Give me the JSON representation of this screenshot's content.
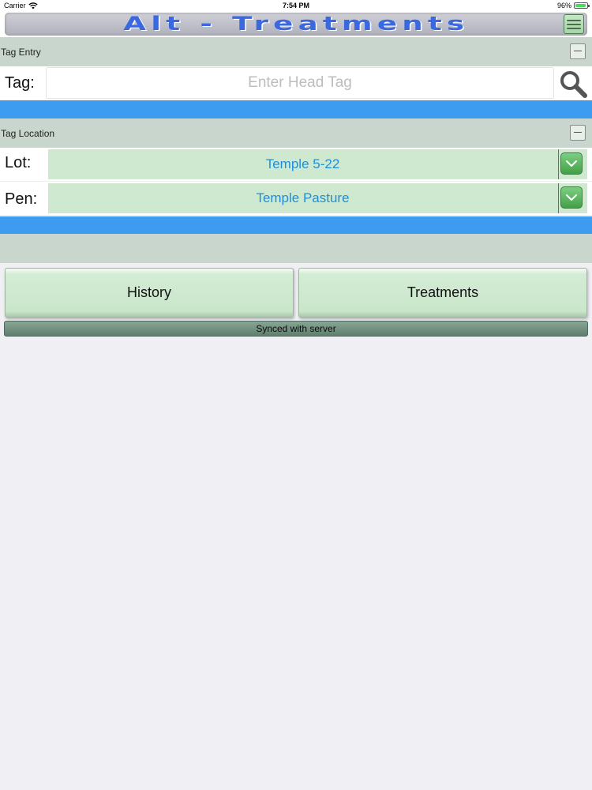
{
  "status_bar": {
    "carrier": "Carrier",
    "time": "7:54 PM",
    "battery_percent": "96%",
    "battery_level": 0.96
  },
  "title_bar": {
    "title": "Alt - Treatments",
    "menu_icon": "hamburger-icon",
    "title_color": "#3a68e0"
  },
  "tag_entry": {
    "header": "Tag Entry",
    "tag_label": "Tag:",
    "tag_placeholder": "Enter Head Tag",
    "tag_value": "",
    "search_icon": "search-icon"
  },
  "tag_location": {
    "header": "Tag Location",
    "lot_label": "Lot:",
    "lot_value": "Temple 5-22",
    "pen_label": "Pen:",
    "pen_value": "Temple Pasture",
    "dropdown_icon": "chevron-down-icon"
  },
  "actions": {
    "history_label": "History",
    "treatments_label": "Treatments"
  },
  "sync": {
    "status": "Synced with server"
  },
  "colors": {
    "accent_blue": "#3d9bf0",
    "section_header": "#c9d6ce",
    "select_bg": "#cfe9d0",
    "select_text": "#1e8fd8",
    "dropdown_green": "#43a047"
  }
}
